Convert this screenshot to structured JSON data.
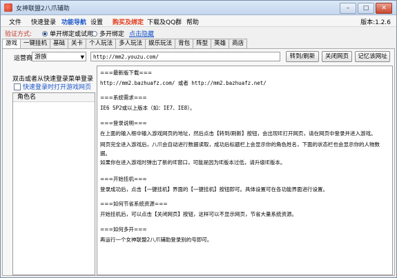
{
  "window": {
    "title": "女神联盟2八爪辅助",
    "minimize": "–",
    "maximize": "□",
    "close": "✕"
  },
  "menubar": {
    "items": [
      {
        "label": "文件",
        "color": "#000000"
      },
      {
        "label": "快速登录",
        "color": "#000000"
      },
      {
        "label": "功能导航",
        "color": "#1a55c9"
      },
      {
        "label": "设置",
        "color": "#000000"
      },
      {
        "label": "购买及绑定",
        "color": "#e03a1a"
      },
      {
        "label": "下载及QQ群",
        "color": "#000000"
      },
      {
        "label": "帮助",
        "color": "#000000"
      }
    ],
    "version": "版本:1.2.6"
  },
  "mode": {
    "label": "验证方式:",
    "option_single": "单开绑定或试用",
    "option_multi": "多开绑定",
    "link": "点击隐藏"
  },
  "tabs": [
    "游戏",
    "一键挂机",
    "基础",
    "关卡",
    "个人玩法",
    "多人玩法",
    "娱乐玩法",
    "背包",
    "阵型",
    "英雄",
    "商店"
  ],
  "toolbar": {
    "operator_label": "运营商",
    "operator_value": "游族",
    "url": "http://mm2.youzu.com/",
    "goto_button": "转到/刷新",
    "close_button": "关闭网页",
    "remember_button": "记忆该网址"
  },
  "left": {
    "hint": "双击或者从快速登录菜单登录",
    "checkbox_label": "快速登录时打开游戏网页",
    "list_header": "角色名"
  },
  "content": {
    "lines": [
      "===最新版下载===",
      "http://mm2.bazhuafz.com/ 或者 http://mm2.bazhuafz.net/",
      "",
      "===系统需求===",
      "IE6 SP2或以上版本（如：IE7、IE8）。",
      "",
      "===登录说明===",
      "在上面的输入框中输入游戏网页的地址，然后点击【转到/刷新】按钮，会出现IE打开网页，请在网页中登录并进入游戏。",
      "网页完全进入游戏后，八爪会自动进行数据读取，成功后标题栏上会显示你的角色姓名，下面的状态栏也会显示你的人物数",
      "据。",
      "如果你在进入游戏时弹出了新的IE窗口，可能是因为IE版本过低，请升级IE版本。",
      "",
      "===开始挂机===",
      "登录成功后，点击【一键挂机】界面的【一键挂机】按钮即可。具体设置可在各功能界面进行设置。",
      "",
      "===如何节省系统资源===",
      "开始挂机后，可以点击【关闭网页】按钮，这样可以不显示网页，节省大量系统资源。",
      "",
      "===如何多开===",
      "再运行一个女神联盟2八爪辅助登录别的号即可。"
    ]
  }
}
